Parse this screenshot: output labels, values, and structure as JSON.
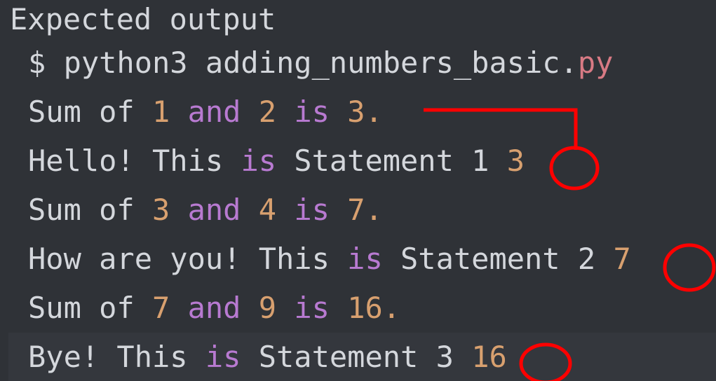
{
  "header": {
    "title": "Expected output"
  },
  "command": {
    "prompt": "$ python3 adding_numbers_basic.",
    "ext": "py"
  },
  "lines": [
    {
      "parts": [
        "Sum of ",
        "1",
        " and ",
        "2",
        " is ",
        "3",
        "."
      ]
    },
    {
      "parts": [
        "Hello! This ",
        "is",
        " Statement 1 ",
        "3"
      ]
    },
    {
      "parts": [
        "Sum of ",
        "3",
        " and ",
        "4",
        " is ",
        "7",
        "."
      ]
    },
    {
      "parts": [
        "How are you! This ",
        "is",
        " Statement 2 ",
        "7"
      ]
    },
    {
      "parts": [
        "Sum of ",
        "7",
        " and ",
        "9",
        " is ",
        "16",
        "."
      ]
    },
    {
      "parts": [
        "Bye! This ",
        "is",
        " Statement 3 ",
        "16"
      ]
    }
  ],
  "annotation": {
    "color": "#ff0000"
  }
}
